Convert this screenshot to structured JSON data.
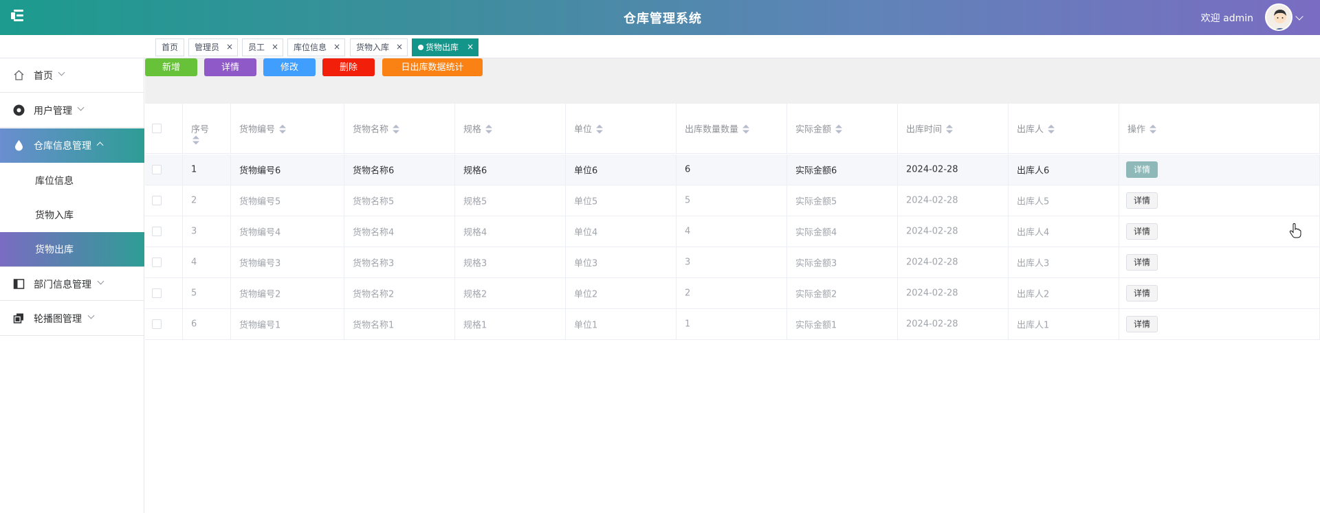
{
  "header": {
    "title": "仓库管理系统",
    "welcome": "欢迎 admin"
  },
  "tabs": [
    {
      "label": "首页"
    },
    {
      "label": "管理员",
      "close": "×"
    },
    {
      "label": "员工",
      "close": "×"
    },
    {
      "label": "库位信息",
      "close": "×"
    },
    {
      "label": "货物入库",
      "close": "×"
    },
    {
      "label": "货物出库",
      "close": "×",
      "active": true
    }
  ],
  "sidebar": {
    "items": [
      {
        "label": "首页",
        "icon": "home-icon"
      },
      {
        "label": "用户管理",
        "icon": "user-icon"
      },
      {
        "label": "仓库信息管理",
        "icon": "drop-icon",
        "open": true
      },
      {
        "label": "库位信息"
      },
      {
        "label": "货物入库"
      },
      {
        "label": "货物出库",
        "active": true
      },
      {
        "label": "部门信息管理",
        "icon": "panel-icon"
      },
      {
        "label": "轮播图管理",
        "icon": "copy-icon"
      }
    ]
  },
  "toolbar": {
    "add": "新增",
    "detail": "详情",
    "edit": "修改",
    "delete": "删除",
    "stats": "日出库数据统计"
  },
  "table": {
    "headers": [
      "序号",
      "货物编号",
      "货物名称",
      "规格",
      "单位",
      "出库数量数量",
      "实际金额",
      "出库时间",
      "出库人",
      "操作"
    ],
    "rows": [
      [
        "1",
        "货物编号6",
        "货物名称6",
        "规格6",
        "单位6",
        "6",
        "实际金额6",
        "2024-02-28",
        "出库人6",
        "详情"
      ],
      [
        "2",
        "货物编号5",
        "货物名称5",
        "规格5",
        "单位5",
        "5",
        "实际金额5",
        "2024-02-28",
        "出库人5",
        "详情"
      ],
      [
        "3",
        "货物编号4",
        "货物名称4",
        "规格4",
        "单位4",
        "4",
        "实际金额4",
        "2024-02-28",
        "出库人4",
        "详情"
      ],
      [
        "4",
        "货物编号3",
        "货物名称3",
        "规格3",
        "单位3",
        "3",
        "实际金额3",
        "2024-02-28",
        "出库人3",
        "详情"
      ],
      [
        "5",
        "货物编号2",
        "货物名称2",
        "规格2",
        "单位2",
        "2",
        "实际金额2",
        "2024-02-28",
        "出库人2",
        "详情"
      ],
      [
        "6",
        "货物编号1",
        "货物名称1",
        "规格1",
        "单位1",
        "1",
        "实际金额1",
        "2024-02-28",
        "出库人1",
        "详情"
      ]
    ]
  },
  "colors": {
    "primary": "#14958a",
    "add": "#67c23a",
    "detail": "#8f59c7",
    "edit": "#409eff",
    "delete": "#f21f0a",
    "stats": "#fa8214"
  }
}
